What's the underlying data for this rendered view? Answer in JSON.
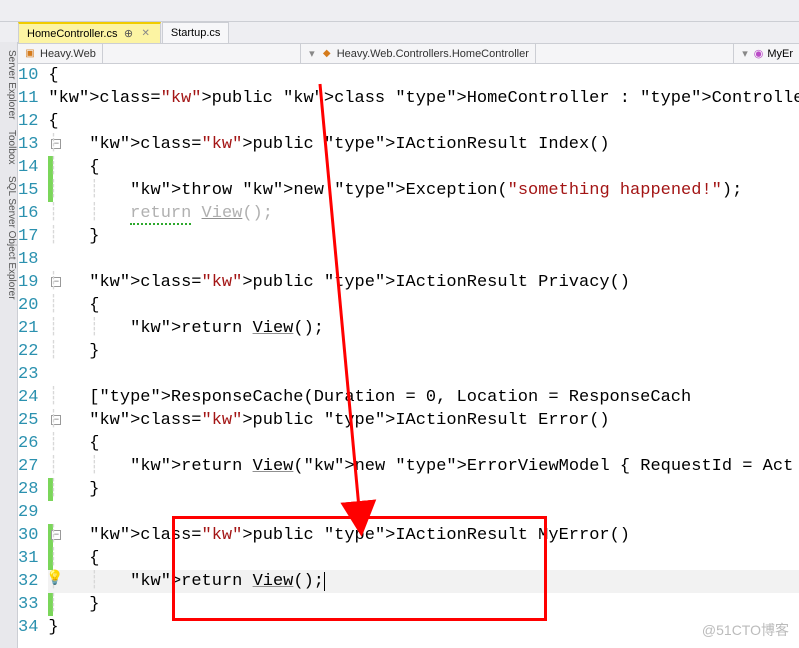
{
  "tabs": [
    {
      "label": "HomeController.cs",
      "active": true
    },
    {
      "label": "Startup.cs",
      "active": false
    }
  ],
  "breadcrumb": {
    "left_project": "Heavy.Web",
    "class_path": "Heavy.Web.Controllers.HomeController",
    "right_member": "MyEr"
  },
  "side_tabs": [
    "Server Explorer",
    "Toolbox",
    "SQL Server Object Explorer"
  ],
  "lines": [
    {
      "n": 10,
      "txt": "{"
    },
    {
      "n": 11,
      "txt": "    public class HomeController : Controller"
    },
    {
      "n": 12,
      "txt": "    {"
    },
    {
      "n": 13,
      "txt": "        public IActionResult Index()"
    },
    {
      "n": 14,
      "txt": "        {"
    },
    {
      "n": 15,
      "txt": "            throw new Exception(\"something happened!\");"
    },
    {
      "n": 16,
      "txt": "            return View();"
    },
    {
      "n": 17,
      "txt": "        }"
    },
    {
      "n": 18,
      "txt": ""
    },
    {
      "n": 19,
      "txt": "        public IActionResult Privacy()"
    },
    {
      "n": 20,
      "txt": "        {"
    },
    {
      "n": 21,
      "txt": "            return View();"
    },
    {
      "n": 22,
      "txt": "        }"
    },
    {
      "n": 23,
      "txt": ""
    },
    {
      "n": 24,
      "txt": "        [ResponseCache(Duration = 0, Location = ResponseCach"
    },
    {
      "n": 25,
      "txt": "        public IActionResult Error()"
    },
    {
      "n": 26,
      "txt": "        {"
    },
    {
      "n": 27,
      "txt": "            return View(new ErrorViewModel { RequestId = Act"
    },
    {
      "n": 28,
      "txt": "        }"
    },
    {
      "n": 29,
      "txt": ""
    },
    {
      "n": 30,
      "txt": "        public IActionResult MyError()"
    },
    {
      "n": 31,
      "txt": "        {"
    },
    {
      "n": 32,
      "txt": "            return View();"
    },
    {
      "n": 33,
      "txt": "        }"
    },
    {
      "n": 34,
      "txt": "    }"
    }
  ],
  "tokens": {
    "public": "public",
    "class": "class",
    "throw": "throw",
    "new": "new",
    "return": "return"
  },
  "watermark": "@51CTO博客"
}
